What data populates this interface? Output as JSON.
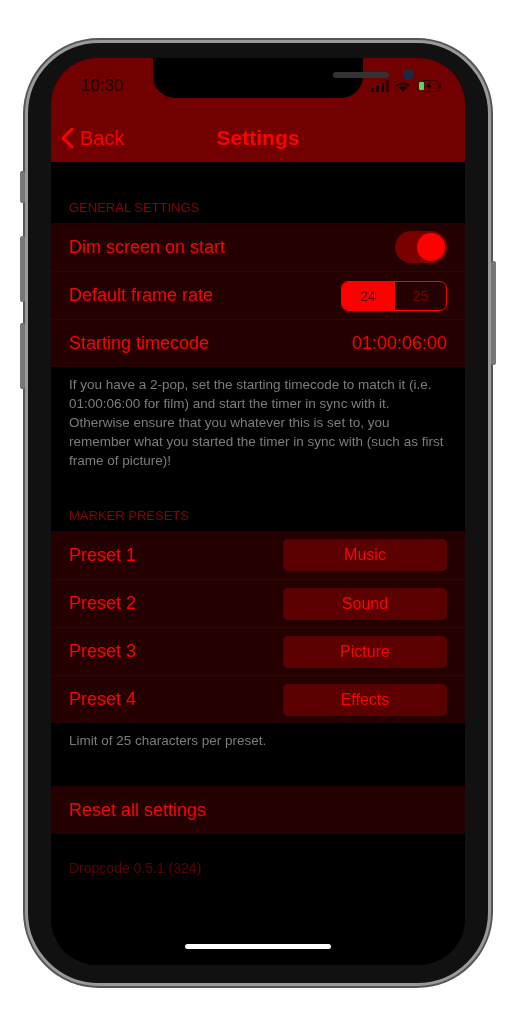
{
  "status_bar": {
    "time": "10:30"
  },
  "nav": {
    "back": "Back",
    "title": "Settings"
  },
  "sections": [
    {
      "header": "GENERAL SETTINGS",
      "rows": [
        {
          "kind": "toggle",
          "label": "Dim screen on start",
          "on": true
        },
        {
          "kind": "segmented",
          "label": "Default frame rate",
          "options": [
            {
              "label": "24",
              "selected": true
            },
            {
              "label": "25",
              "selected": false
            }
          ]
        },
        {
          "kind": "value",
          "label": "Starting timecode",
          "value": "01:00:06:00"
        }
      ],
      "footer": "If you have a 2-pop, set the starting timecode to match it (i.e. 01:00:06:00 for film) and start the timer in sync with it. Otherwise ensure that you whatever this is set to, you remember what you started the timer in sync with (such as first frame of picture)!"
    },
    {
      "header": "MARKER PRESETS",
      "rows": [
        {
          "kind": "preset",
          "label": "Preset 1",
          "value": "Music"
        },
        {
          "kind": "preset",
          "label": "Preset 2",
          "value": "Sound"
        },
        {
          "kind": "preset",
          "label": "Preset 3",
          "value": "Picture"
        },
        {
          "kind": "preset",
          "label": "Preset 4",
          "value": "Effects"
        }
      ],
      "footer": "Limit of 25 characters per preset."
    },
    {
      "rows": [
        {
          "kind": "action",
          "label": "Reset all settings"
        }
      ]
    }
  ],
  "version": "Dropcode 0.5.1 (324)"
}
